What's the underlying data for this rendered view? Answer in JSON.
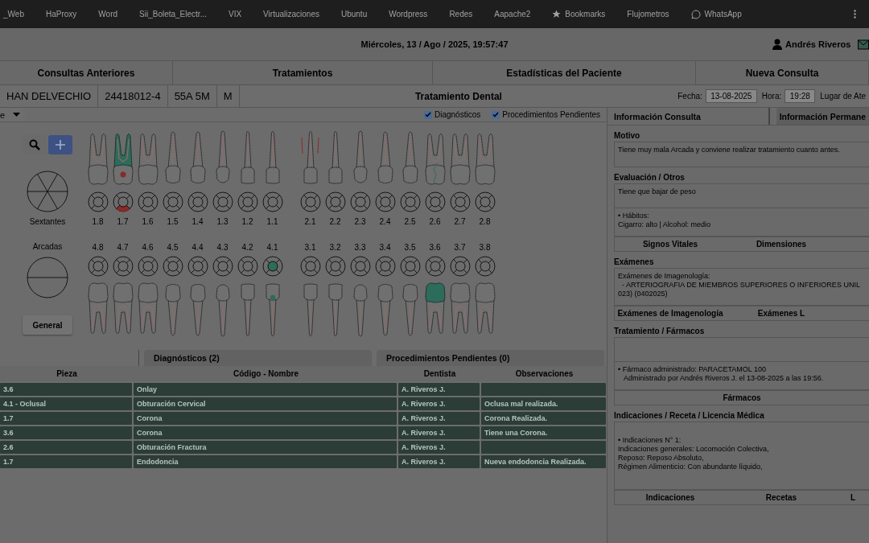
{
  "bookmarks": [
    {
      "label": "_Web",
      "kind": "plain"
    },
    {
      "label": "HaProxy",
      "kind": "plain"
    },
    {
      "label": "Word",
      "kind": "plain"
    },
    {
      "label": "Sii_Boleta_Electr...",
      "kind": "plain"
    },
    {
      "label": "VIX",
      "kind": "plain"
    },
    {
      "label": "Virtualizaciones",
      "kind": "plain"
    },
    {
      "label": "Ubuntu",
      "kind": "plain"
    },
    {
      "label": "Wordpress",
      "kind": "plain"
    },
    {
      "label": "Redes",
      "kind": "plain"
    },
    {
      "label": "Aapache2",
      "kind": "plain"
    },
    {
      "label": "Bookmarks",
      "kind": "starred"
    },
    {
      "label": "Flujometros",
      "kind": "plain"
    },
    {
      "label": "WhatsApp",
      "kind": "app"
    }
  ],
  "header": {
    "datetime": "Miércoles, 13 / Ago / 2025, 19:57:47",
    "user": "Andrés Riveros"
  },
  "tabs": [
    {
      "label": "Consultas Anteriores"
    },
    {
      "label": "Tratamientos"
    },
    {
      "label": "Estadísticas del Paciente"
    },
    {
      "label": "Nueva Consulta"
    }
  ],
  "patient": {
    "name": "HAN DELVECHIO",
    "id": "24418012-4",
    "age": "55A 5M",
    "sex": "M",
    "title": "Tratamiento Dental",
    "date_label": "Fecha:",
    "date": "13-08-2025",
    "time_label": "Hora:",
    "time": "19:28",
    "place_label": "Lugar de Ate"
  },
  "chart_toolbar": {
    "dropdown": "e",
    "filters": [
      {
        "label": "Diagnósticos",
        "checked": true
      },
      {
        "label": "Procedimientos Pendientes",
        "checked": true
      }
    ]
  },
  "odontogram": {
    "sextants_label": "Sextantes",
    "arches_label": "Arcadas",
    "general_button": "General",
    "upper": [
      {
        "number": "1.8",
        "kind": "molar",
        "endodontics": false,
        "caries": false,
        "periodontal": false,
        "fracture": false,
        "filling": false,
        "crown": false
      },
      {
        "number": "1.7",
        "kind": "molar",
        "endodontics": true,
        "caries": true,
        "periodontal": false,
        "fracture": false,
        "filling": false,
        "crown": false
      },
      {
        "number": "1.6",
        "kind": "molar",
        "endodontics": false,
        "caries": false,
        "periodontal": false,
        "fracture": false,
        "filling": false,
        "crown": false
      },
      {
        "number": "1.5",
        "kind": "premolar",
        "endodontics": false,
        "caries": false,
        "periodontal": false,
        "fracture": false,
        "filling": false,
        "crown": false
      },
      {
        "number": "1.4",
        "kind": "premolar",
        "endodontics": false,
        "caries": false,
        "periodontal": false,
        "fracture": false,
        "filling": false,
        "crown": false
      },
      {
        "number": "1.3",
        "kind": "canine",
        "endodontics": false,
        "caries": false,
        "periodontal": false,
        "fracture": false,
        "filling": false,
        "crown": false
      },
      {
        "number": "1.2",
        "kind": "incisor",
        "endodontics": false,
        "caries": false,
        "periodontal": false,
        "fracture": false,
        "filling": false,
        "crown": false
      },
      {
        "number": "1.1",
        "kind": "incisor",
        "endodontics": false,
        "caries": false,
        "periodontal": false,
        "fracture": false,
        "filling": false,
        "crown": false
      },
      {
        "number": "2.1",
        "kind": "incisor",
        "endodontics": false,
        "caries": false,
        "periodontal": true,
        "fracture": false,
        "filling": false,
        "crown": false
      },
      {
        "number": "2.2",
        "kind": "incisor",
        "endodontics": false,
        "caries": false,
        "periodontal": false,
        "fracture": false,
        "filling": false,
        "crown": false
      },
      {
        "number": "2.3",
        "kind": "canine",
        "endodontics": false,
        "caries": false,
        "periodontal": false,
        "fracture": false,
        "filling": false,
        "crown": false
      },
      {
        "number": "2.4",
        "kind": "premolar",
        "endodontics": false,
        "caries": false,
        "periodontal": false,
        "fracture": false,
        "filling": false,
        "crown": false
      },
      {
        "number": "2.5",
        "kind": "premolar",
        "endodontics": false,
        "caries": false,
        "periodontal": false,
        "fracture": false,
        "filling": false,
        "crown": false
      },
      {
        "number": "2.6",
        "kind": "molar",
        "endodontics": false,
        "caries": false,
        "periodontal": false,
        "fracture": true,
        "filling": false,
        "crown": false
      },
      {
        "number": "2.7",
        "kind": "molar",
        "endodontics": false,
        "caries": false,
        "periodontal": false,
        "fracture": false,
        "filling": false,
        "crown": false
      },
      {
        "number": "2.8",
        "kind": "molar",
        "endodontics": false,
        "caries": false,
        "periodontal": false,
        "fracture": false,
        "filling": false,
        "crown": false
      }
    ],
    "lower": [
      {
        "number": "4.8",
        "kind": "molar",
        "endodontics": false,
        "caries": false,
        "periodontal": false,
        "fracture": false,
        "filling": false,
        "crown": false
      },
      {
        "number": "4.7",
        "kind": "molar",
        "endodontics": false,
        "caries": false,
        "periodontal": false,
        "fracture": false,
        "filling": false,
        "crown": false
      },
      {
        "number": "4.6",
        "kind": "molar",
        "endodontics": false,
        "caries": false,
        "periodontal": false,
        "fracture": false,
        "filling": false,
        "crown": false
      },
      {
        "number": "4.5",
        "kind": "premolar",
        "endodontics": false,
        "caries": false,
        "periodontal": false,
        "fracture": false,
        "filling": false,
        "crown": false
      },
      {
        "number": "4.4",
        "kind": "premolar",
        "endodontics": false,
        "caries": false,
        "periodontal": false,
        "fracture": false,
        "filling": false,
        "crown": false
      },
      {
        "number": "4.3",
        "kind": "canine",
        "endodontics": false,
        "caries": false,
        "periodontal": false,
        "fracture": false,
        "filling": false,
        "crown": false
      },
      {
        "number": "4.2",
        "kind": "incisor",
        "endodontics": false,
        "caries": false,
        "periodontal": false,
        "fracture": false,
        "filling": false,
        "crown": false
      },
      {
        "number": "4.1",
        "kind": "incisor",
        "endodontics": false,
        "caries": false,
        "periodontal": false,
        "fracture": false,
        "filling": true,
        "crown": false
      },
      {
        "number": "3.1",
        "kind": "incisor",
        "endodontics": false,
        "caries": false,
        "periodontal": false,
        "fracture": false,
        "filling": false,
        "crown": false
      },
      {
        "number": "3.2",
        "kind": "incisor",
        "endodontics": false,
        "caries": false,
        "periodontal": false,
        "fracture": false,
        "filling": false,
        "crown": false
      },
      {
        "number": "3.3",
        "kind": "canine",
        "endodontics": false,
        "caries": false,
        "periodontal": false,
        "fracture": false,
        "filling": false,
        "crown": false
      },
      {
        "number": "3.4",
        "kind": "premolar",
        "endodontics": false,
        "caries": false,
        "periodontal": false,
        "fracture": false,
        "filling": false,
        "crown": false
      },
      {
        "number": "3.5",
        "kind": "premolar",
        "endodontics": false,
        "caries": false,
        "periodontal": false,
        "fracture": false,
        "filling": false,
        "crown": false
      },
      {
        "number": "3.6",
        "kind": "molar",
        "endodontics": false,
        "caries": false,
        "periodontal": false,
        "fracture": false,
        "filling": false,
        "crown": true
      },
      {
        "number": "3.7",
        "kind": "molar",
        "endodontics": false,
        "caries": false,
        "periodontal": false,
        "fracture": false,
        "filling": false,
        "crown": false
      },
      {
        "number": "3.8",
        "kind": "molar",
        "endodontics": false,
        "caries": false,
        "periodontal": false,
        "fracture": false,
        "filling": false,
        "crown": false
      }
    ]
  },
  "records": {
    "tabs": [
      {
        "label": "Diagnósticos (2)"
      },
      {
        "label": "Procedimientos Pendientes (0)"
      }
    ],
    "columns": [
      "Pieza",
      "Código - Nombre",
      "Dentista",
      "Observaciones"
    ],
    "rows": [
      {
        "piece": "3.6",
        "code": "Onlay",
        "dentist": "A. Riveros J."
      },
      {
        "piece": "4.1 - Oclusal",
        "code": "Obturación Cervical",
        "dentist": "A. Riveros J.",
        "notes": "Oclusa mal realizada."
      },
      {
        "piece": "1.7",
        "code": "Corona",
        "dentist": "A. Riveros J.",
        "notes": "Corona Realizada."
      },
      {
        "piece": "3.6",
        "code": "Corona",
        "dentist": "A. Riveros J.",
        "notes": "Tiene una Corona."
      },
      {
        "piece": "2.6",
        "code": "Obturación Fractura",
        "dentist": "A. Riveros J."
      },
      {
        "piece": "1.7",
        "code": "Endodoncia",
        "dentist": "A. Riveros J.",
        "notes": "Nueva endodoncia Realizada."
      }
    ]
  },
  "consultation": {
    "tabs": [
      {
        "label": "Información Consulta",
        "selected": true
      },
      {
        "label": "Información Permane",
        "selected": false
      }
    ],
    "sections": [
      {
        "title": "Motivo",
        "boxes": [
          {
            "kind": "text",
            "text": "Tiene muy mala Arcada y conviene realizar tratamiento cuanto antes."
          }
        ]
      },
      {
        "title": "Evaluación / Otros",
        "boxes": [
          {
            "kind": "text",
            "text": "Tiene que bajar de peso"
          },
          {
            "kind": "text",
            "text": "• Hábitos:\nCigarro: alto | Alcohol: medio"
          }
        ],
        "buttons": [
          "Signos Vitales",
          "Dimensiones"
        ]
      },
      {
        "title": "Exámenes",
        "boxes": [
          {
            "kind": "text",
            "text": "Exámenes de Imagenología:\n  - ARTERIOGRAFIA DE MIEMBROS SUPERIORES O INFERIORES UNIL\n023) (0402025)"
          }
        ],
        "buttons": [
          "Exámenes de Imagenología",
          "Exámenes L"
        ]
      },
      {
        "title": "Tratamiento / Fármacos",
        "boxes": [
          {
            "kind": "blank"
          },
          {
            "kind": "text",
            "text": "• Fármaco administrado: PARACETAMOL 100\n   Administrado por Andrés Riveros J. el 13-08-2025 a las 19:56."
          }
        ],
        "buttons": [
          "Fármacos"
        ]
      },
      {
        "title": "Indicaciones / Receta / Licencia Médica",
        "boxes": [
          {
            "kind": "text",
            "text": "• Indicaciones N° 1:\nIndicaciones generales: Locomoción Colectiva,\nReposo: Reposo Absoluto,\nRégimen Alimenticio: Con abundante líquido,"
          }
        ],
        "buttons": [
          "Indicaciones",
          "Recetas",
          "L"
        ]
      }
    ]
  }
}
